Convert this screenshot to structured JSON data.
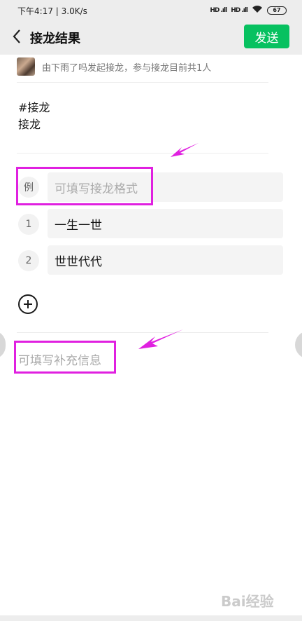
{
  "status_bar": {
    "time": "下午4:17 | 3.0K/s",
    "signal1": "HD .ıll",
    "signal2": "HD .ıll",
    "battery": "67"
  },
  "nav": {
    "title": "接龙结果",
    "send_label": "发送"
  },
  "creator": {
    "text": "由下雨了吗发起接龙，参与接龙目前共1人"
  },
  "topic": {
    "line1": "#接龙",
    "line2": "接龙"
  },
  "rows": [
    {
      "badge": "例",
      "placeholder": "可填写接龙格式"
    },
    {
      "badge": "1",
      "value": "一生一世"
    },
    {
      "badge": "2",
      "value": "世世代代"
    }
  ],
  "extra_info_placeholder": "可填写补充信息",
  "watermark": "Bai经验",
  "icons": {
    "back": "chevron-left-icon",
    "add": "plus-circle-icon",
    "wifi": "wifi-icon",
    "battery": "battery-icon"
  },
  "colors": {
    "accent": "#07c160",
    "highlight": "#e020e0"
  }
}
